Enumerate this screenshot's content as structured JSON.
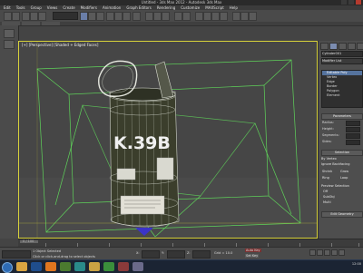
{
  "window": {
    "title": "Untitled - 3ds Max 2012 - Autodesk 3ds Max"
  },
  "menu": {
    "items": [
      "Edit",
      "Tools",
      "Group",
      "Views",
      "Create",
      "Modifiers",
      "Animation",
      "Graph Editors",
      "Rendering",
      "Customize",
      "MAXScript",
      "Help"
    ]
  },
  "viewport": {
    "label": "[+] [Perspective] [Shaded + Edged Faces]",
    "object_text": "K.39B",
    "colors": {
      "border": "#d6d03a",
      "wireframe_green": "#5fd35a",
      "label_white": "#f0f0f0",
      "can_body": "#3a3c2c"
    }
  },
  "cmdpanel": {
    "object_name": "Cylinder001",
    "modifier_list_label": "Modifier List",
    "modifiers": [
      "Editable Poly",
      "Vertex",
      "Edge",
      "Border",
      "Polygon",
      "Element"
    ],
    "selected_modifier_index": 0,
    "sections": {
      "parameters": "Parameters",
      "selection": "Selection",
      "edit_geometry": "Edit Geometry"
    },
    "params": [
      {
        "label": "Radius:",
        "value": ""
      },
      {
        "label": "Height:",
        "value": ""
      },
      {
        "label": "Segments:",
        "value": ""
      },
      {
        "label": "Sides:",
        "value": ""
      }
    ],
    "options": [
      "By Vertex",
      "Ignore Backfacing",
      "Shrink",
      "Grow",
      "Ring",
      "Loop",
      "Preview Selection",
      "Off",
      "SubObj",
      "Multi"
    ]
  },
  "timeline": {
    "frame_text": "0 / 100",
    "ticks": [
      "0",
      "10",
      "20",
      "30",
      "40",
      "50",
      "60",
      "70",
      "80",
      "90",
      "100"
    ]
  },
  "status": {
    "selected_text": "1 Object Selected",
    "prompt_text": "Click or click-and-drag to select objects",
    "coord_x": "X:",
    "coord_y": "Y:",
    "coord_z": "Z:",
    "grid_text": "Grid = 10.0",
    "autokey_label": "Auto Key",
    "setkey_label": "Set Key"
  },
  "taskbar": {
    "apps": [
      {
        "icon": "explorer-icon",
        "color": "#d9a441"
      },
      {
        "icon": "photoshop-icon",
        "color": "#1f4d8c"
      },
      {
        "icon": "firefox-icon",
        "color": "#e0761f"
      },
      {
        "icon": "media-icon",
        "color": "#4b7b2f"
      },
      {
        "icon": "3dsmax-icon",
        "color": "#2a8a8a"
      },
      {
        "icon": "folder-icon",
        "color": "#caa243"
      },
      {
        "icon": "chrome-icon",
        "color": "#3b8f3b"
      },
      {
        "icon": "app-icon",
        "color": "#8a3a3a"
      },
      {
        "icon": "app2-icon",
        "color": "#6a6a8a"
      }
    ],
    "clock": "12:00"
  }
}
